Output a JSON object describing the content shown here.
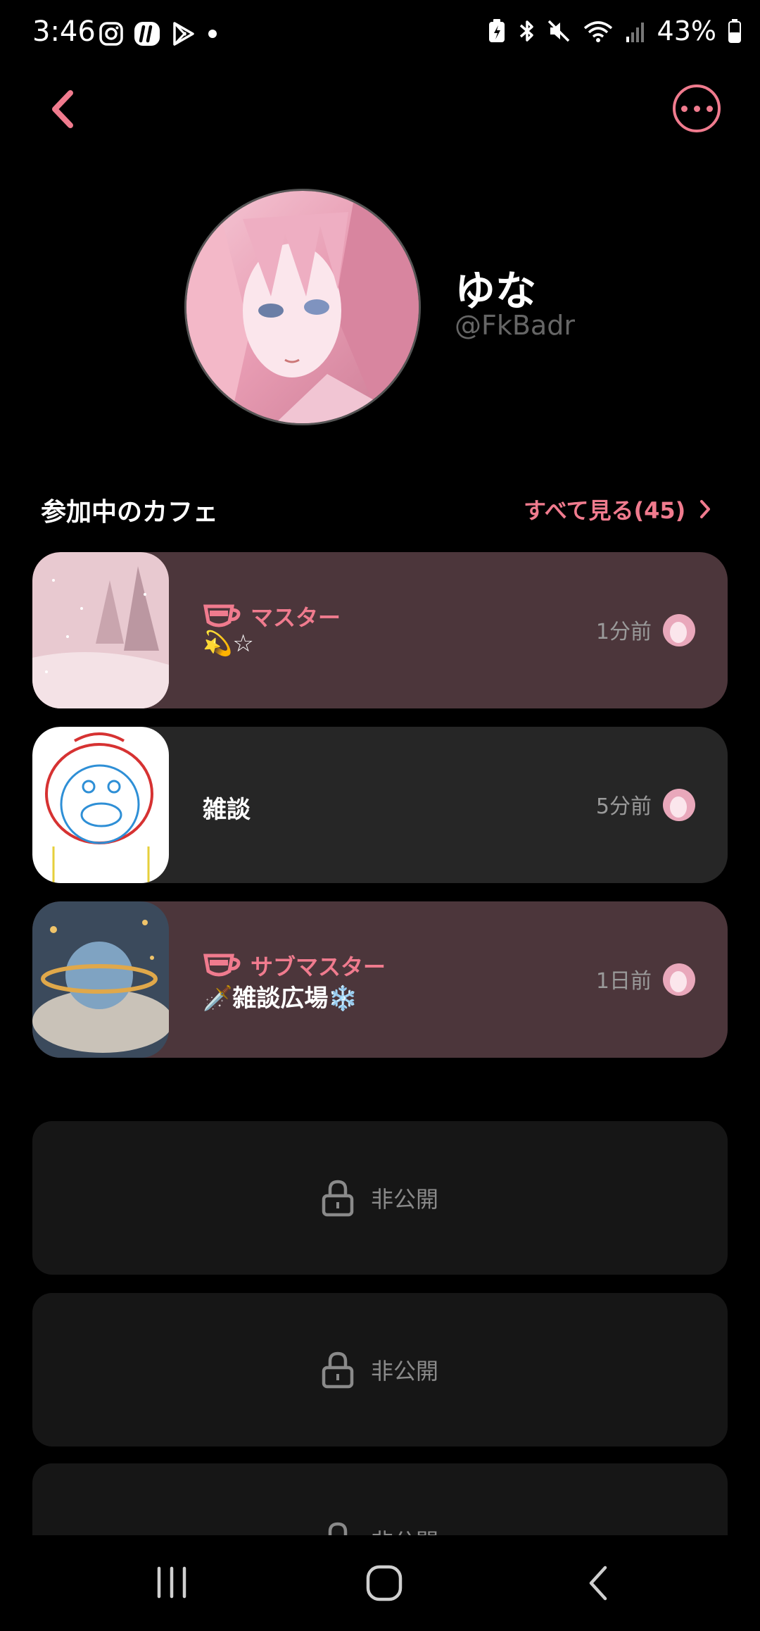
{
  "status_bar": {
    "time": "3:46",
    "battery": "43%",
    "left_icons": [
      "instagram-icon",
      "app-icon",
      "play-store-icon",
      "dot-icon"
    ],
    "right_icons": [
      "battery-saver-icon",
      "bluetooth-icon",
      "mute-icon",
      "wifi-icon",
      "signal-icon",
      "battery-icon"
    ]
  },
  "header": {
    "back_icon": "chevron-left-icon",
    "more_icon": "more-horizontal-icon"
  },
  "profile": {
    "name": "ゆな",
    "handle": "@FkBadr"
  },
  "section": {
    "title": "参加中のカフェ",
    "see_all": "すべて見る(45)"
  },
  "cafes": [
    {
      "role": "マスター",
      "name": "💫☆",
      "time": "1分前",
      "highlighted": true
    },
    {
      "role": "",
      "name": "雑談",
      "time": "5分前",
      "highlighted": false
    },
    {
      "role": "サブマスター",
      "name": "🗡️雑談広場❄️",
      "time": "1日前",
      "highlighted": true
    }
  ],
  "private_items": [
    {
      "label": "非公開"
    },
    {
      "label": "非公開"
    },
    {
      "label": "非公開"
    }
  ],
  "colors": {
    "accent": "#f07b8e",
    "owned_card": "#4c363b",
    "plain_card": "#262626",
    "private_card": "#161616",
    "background": "#000000"
  }
}
